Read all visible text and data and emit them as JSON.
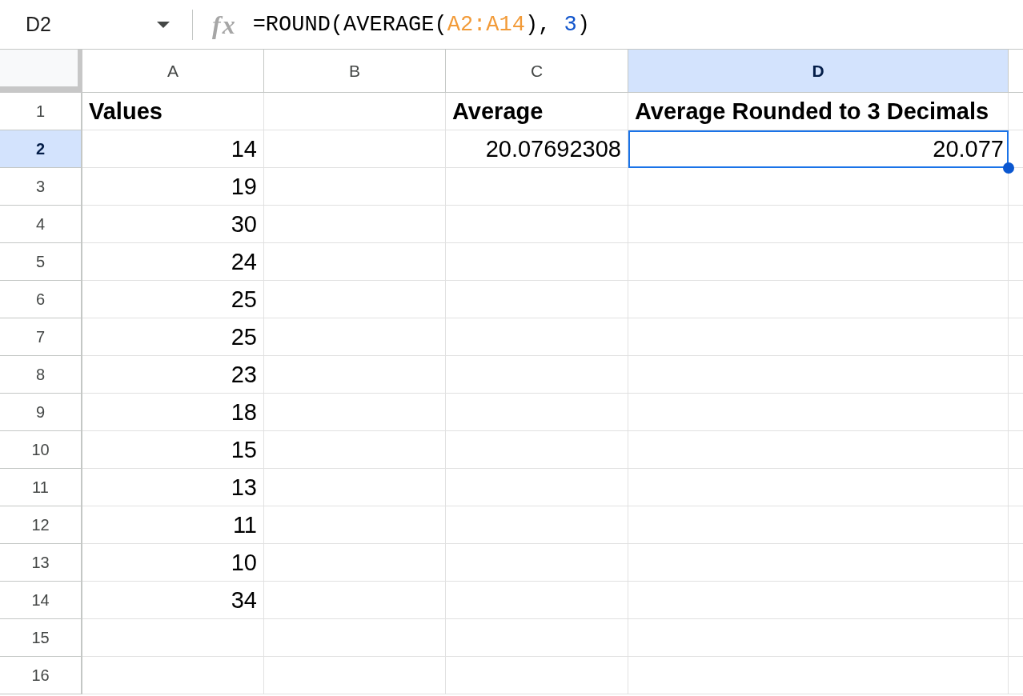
{
  "name_box": {
    "value": "D2"
  },
  "formula_bar": {
    "icon": "fx",
    "tokens": [
      {
        "text": "=ROUND(AVERAGE(",
        "kind": "plain"
      },
      {
        "text": "A2:A14",
        "kind": "range"
      },
      {
        "text": "), ",
        "kind": "plain"
      },
      {
        "text": "3",
        "kind": "number"
      },
      {
        "text": ")",
        "kind": "plain"
      }
    ]
  },
  "columns": [
    {
      "label": "A",
      "selected": false
    },
    {
      "label": "B",
      "selected": false
    },
    {
      "label": "C",
      "selected": false
    },
    {
      "label": "D",
      "selected": true
    }
  ],
  "rows": [
    {
      "label": "1",
      "selected": false,
      "cells": [
        {
          "text": "Values",
          "kind": "label"
        },
        null,
        {
          "text": "Average",
          "kind": "label"
        },
        {
          "text": "Average Rounded to 3 Decimals",
          "kind": "label"
        }
      ]
    },
    {
      "label": "2",
      "selected": true,
      "cells": [
        {
          "text": "14",
          "kind": "number"
        },
        null,
        {
          "text": "20.07692308",
          "kind": "number"
        },
        {
          "text": "20.077",
          "kind": "number"
        }
      ]
    },
    {
      "label": "3",
      "selected": false,
      "cells": [
        {
          "text": "19",
          "kind": "number"
        }
      ]
    },
    {
      "label": "4",
      "selected": false,
      "cells": [
        {
          "text": "30",
          "kind": "number"
        }
      ]
    },
    {
      "label": "5",
      "selected": false,
      "cells": [
        {
          "text": "24",
          "kind": "number"
        }
      ]
    },
    {
      "label": "6",
      "selected": false,
      "cells": [
        {
          "text": "25",
          "kind": "number"
        }
      ]
    },
    {
      "label": "7",
      "selected": false,
      "cells": [
        {
          "text": "25",
          "kind": "number"
        }
      ]
    },
    {
      "label": "8",
      "selected": false,
      "cells": [
        {
          "text": "23",
          "kind": "number"
        }
      ]
    },
    {
      "label": "9",
      "selected": false,
      "cells": [
        {
          "text": "18",
          "kind": "number"
        }
      ]
    },
    {
      "label": "10",
      "selected": false,
      "cells": [
        {
          "text": "15",
          "kind": "number"
        }
      ]
    },
    {
      "label": "11",
      "selected": false,
      "cells": [
        {
          "text": "13",
          "kind": "number"
        }
      ]
    },
    {
      "label": "12",
      "selected": false,
      "cells": [
        {
          "text": "11",
          "kind": "number"
        }
      ]
    },
    {
      "label": "13",
      "selected": false,
      "cells": [
        {
          "text": "10",
          "kind": "number"
        }
      ]
    },
    {
      "label": "14",
      "selected": false,
      "cells": [
        {
          "text": "34",
          "kind": "number"
        }
      ]
    },
    {
      "label": "15",
      "selected": false
    },
    {
      "label": "16",
      "selected": false
    }
  ]
}
